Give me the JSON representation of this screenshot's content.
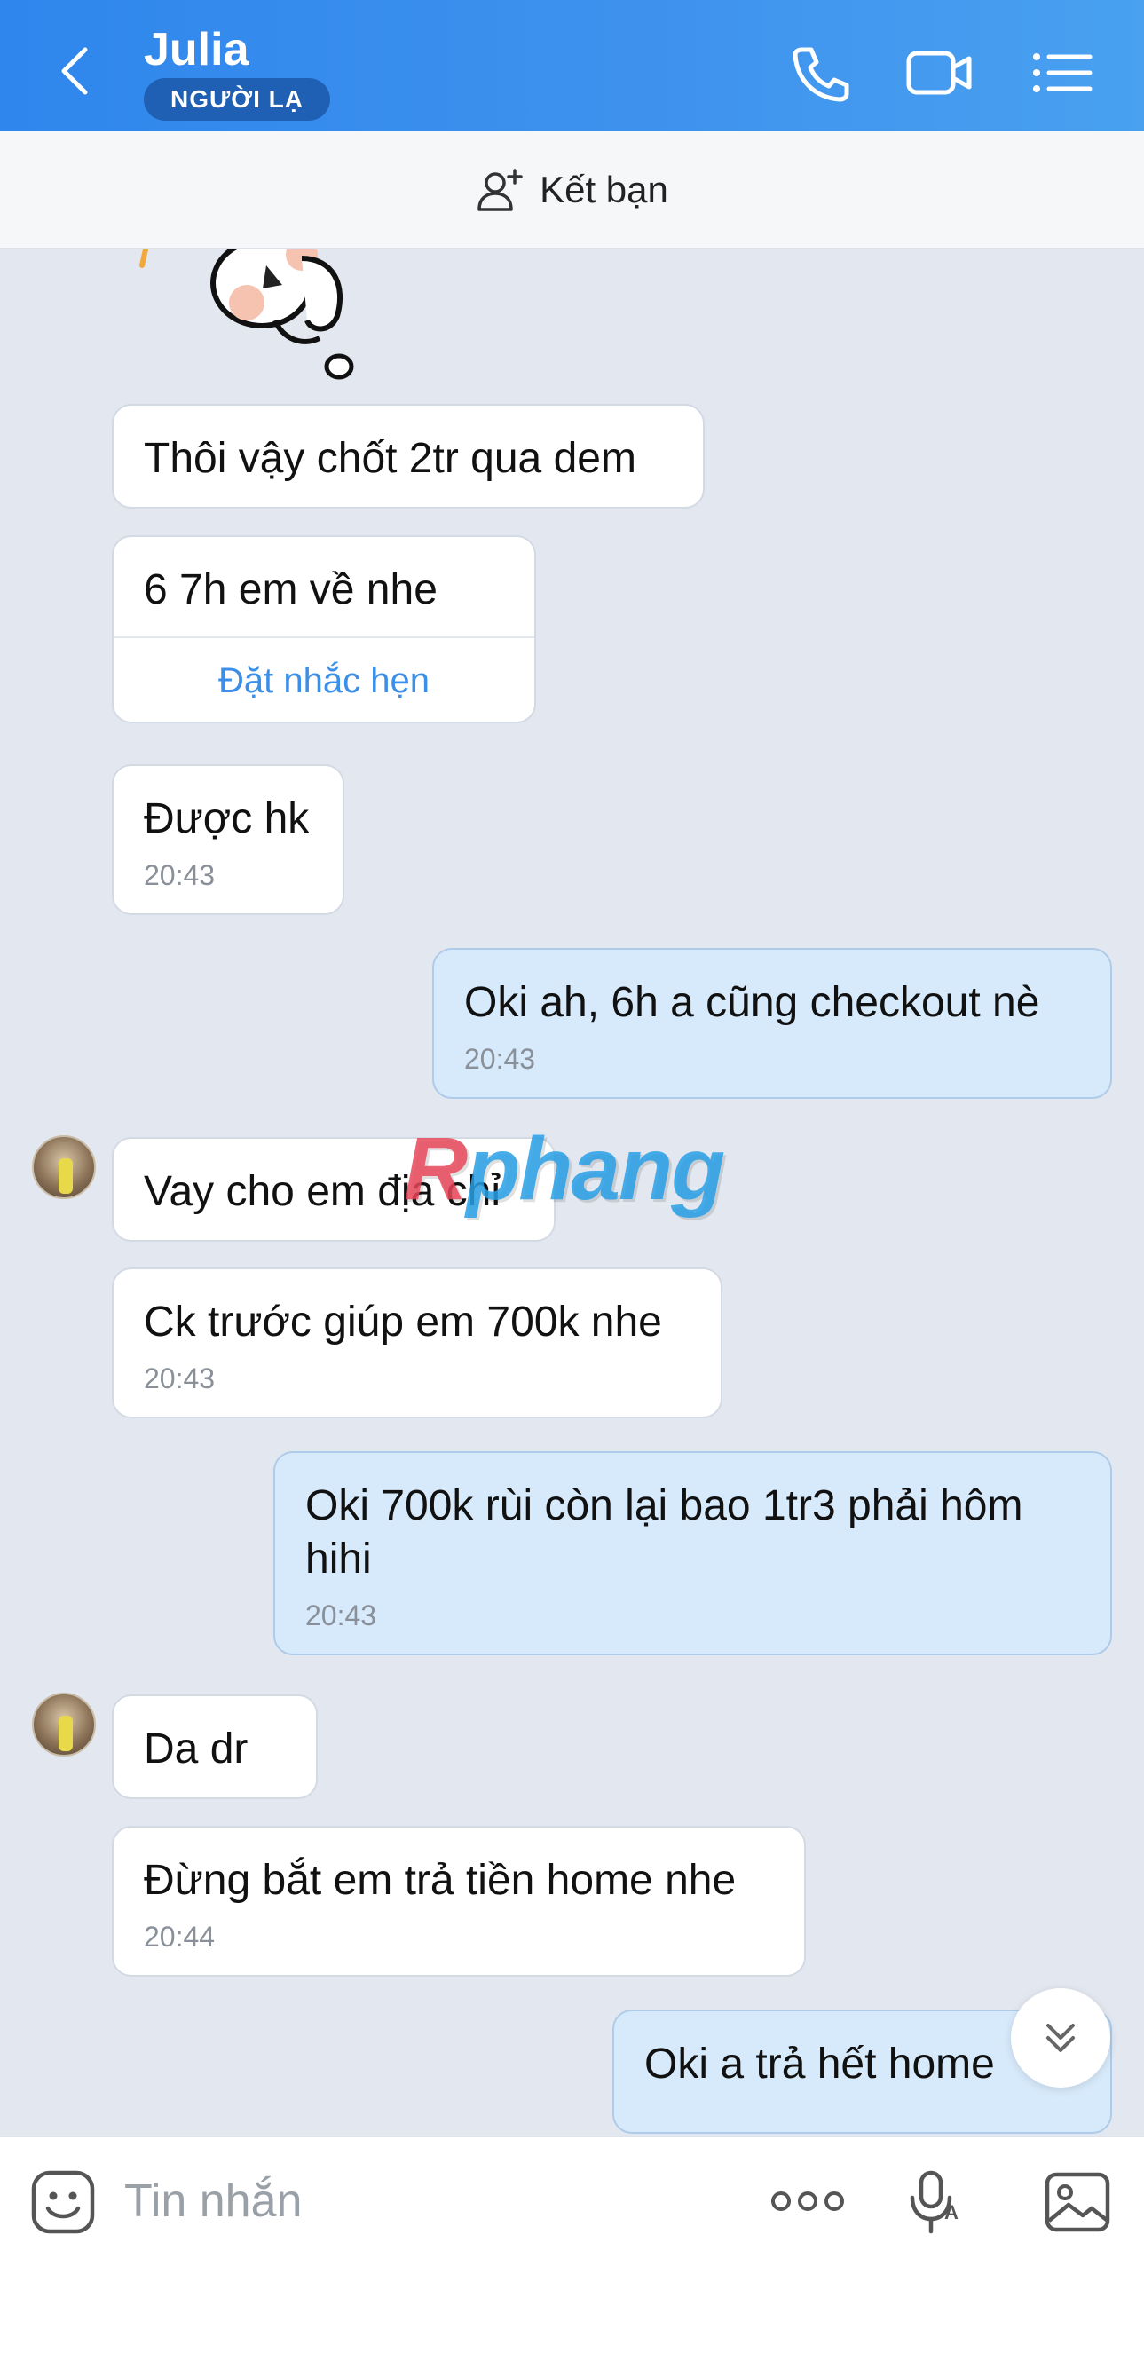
{
  "header": {
    "title": "Julia",
    "badge": "NGƯỜI LẠ",
    "icons": [
      "back-arrow-icon",
      "phone-icon",
      "video-call-icon",
      "menu-list-icon"
    ]
  },
  "friend_bar": {
    "label": "Kết bạn",
    "icon": "add-friend-icon"
  },
  "messages": [
    {
      "from": "them",
      "text": "Thôi vậy chốt 2tr qua dem"
    },
    {
      "from": "them",
      "text": "6 7h em về nhe",
      "action": "Đặt nhắc hẹn"
    },
    {
      "from": "them",
      "text": "Được hk",
      "time": "20:43"
    },
    {
      "from": "me",
      "text": "Oki ah, 6h a cũng checkout nè",
      "time": "20:43"
    },
    {
      "from": "them",
      "text": "Vay cho em địa chỉ"
    },
    {
      "from": "them",
      "text": "Ck trước giúp em 700k nhe",
      "time": "20:43"
    },
    {
      "from": "me",
      "text": "Oki 700k rùi còn lại bao 1tr3 phải hôm hihi",
      "time": "20:43"
    },
    {
      "from": "them",
      "text": "Da dr"
    },
    {
      "from": "them",
      "text": "Đừng bắt em trả tiền home nhe",
      "time": "20:44"
    },
    {
      "from": "me",
      "text": "Oki a trả hết home"
    }
  ],
  "watermark": {
    "part1": "R",
    "part2": "phang"
  },
  "composer": {
    "placeholder": "Tin nhắn",
    "icons": [
      "emoji-icon",
      "more-options-icon",
      "voice-to-text-icon",
      "image-icon"
    ]
  },
  "colors": {
    "header": "#2f86ec",
    "my_bubble": "#d7eafb",
    "link": "#3b8fe8"
  }
}
